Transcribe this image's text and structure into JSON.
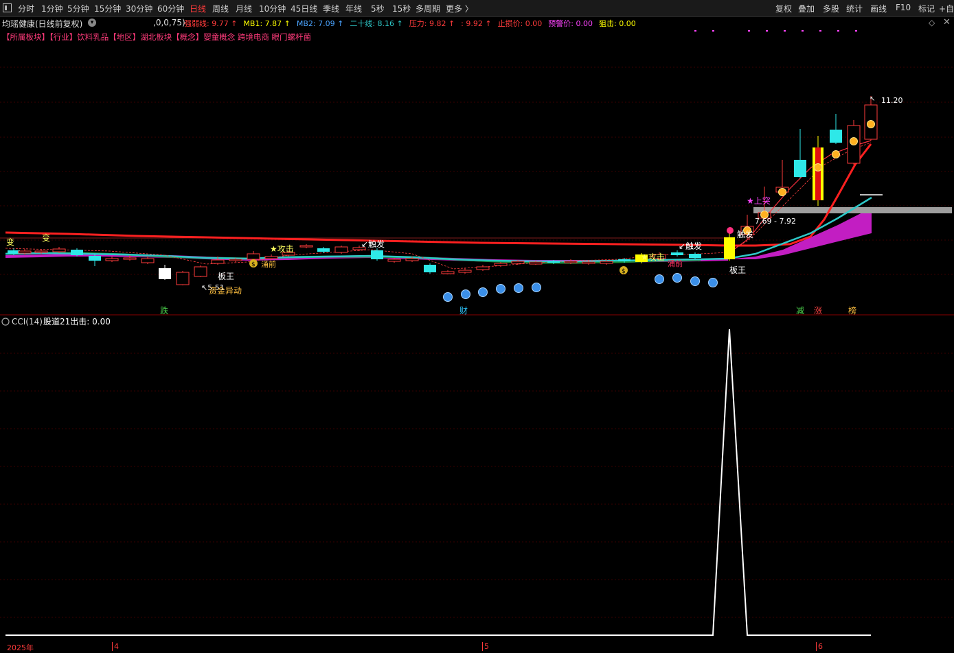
{
  "toolbar": {
    "tabs": [
      "分时",
      "1分钟",
      "5分钟",
      "15分钟",
      "30分钟",
      "60分钟",
      "日线",
      "周线",
      "月线",
      "10分钟",
      "45日线",
      "季线",
      "年线",
      "5秒",
      "15秒",
      "多周期",
      "更多 〉"
    ],
    "active_tab": "日线",
    "right_buttons": [
      "复权",
      "叠加",
      "多股",
      "统计",
      "画线",
      "F10",
      "标记",
      "+自"
    ]
  },
  "stock": {
    "title": "均瑶健康(日线前复权)",
    "params": ",0,0,75)",
    "indicators": [
      {
        "label": "强弱线:",
        "value": "9.77",
        "arrow": "↑",
        "color": "#ff3b3b"
      },
      {
        "label": "MB1:",
        "value": "7.87",
        "arrow": "↑",
        "color": "#ffff00"
      },
      {
        "label": "MB2:",
        "value": "7.09",
        "arrow": "↑",
        "color": "#4aa3ff"
      },
      {
        "label": "二十线:",
        "value": "8.16",
        "arrow": "↑",
        "color": "#2ec8c8"
      },
      {
        "label": "压力:",
        "value": "9.82",
        "arrow": "↑",
        "color": "#ff3b3b"
      },
      {
        "label": ":",
        "value": "9.92",
        "arrow": "↑",
        "color": "#ff3b3b"
      },
      {
        "label": "止损价:",
        "value": "0.00",
        "arrow": "",
        "color": "#ff3b3b"
      },
      {
        "label": "预警价:",
        "value": "0.00",
        "arrow": "",
        "color": "#ff44ff"
      },
      {
        "label": "狙击:",
        "value": "0.00",
        "arrow": "",
        "color": "#ffff00"
      }
    ],
    "sectors": "【所属板块】【行业】饮料乳品【地区】湖北板块【概念】婴童概念 跨境电商 眼门螺杆菌"
  },
  "main_labels": {
    "bian1": "变",
    "bian2": "变",
    "attack1": "★攻击",
    "attack2": "★攻击",
    "trigger1": "↙触发",
    "trigger2": "↙触发",
    "trigger3": "触发",
    "banwang1": "板王",
    "banwang2": "板王",
    "lowprice": "↖5.51",
    "capital": "资金异动",
    "yongqian": "涌前",
    "yongqian2": "涌前",
    "shangtu": "★上突",
    "range": "7.69 - 7.92",
    "high": "11.20",
    "die": "跌",
    "cai": "财",
    "jian": "减",
    "zhang": "涨",
    "bang": "榜",
    "dollar": "$"
  },
  "chart_data": {
    "type": "candlestick",
    "title": "均瑶健康(日线前复权)",
    "price_high": 11.2,
    "price_low": 5.51,
    "series": [
      {
        "name": "强弱线",
        "last": 9.77
      },
      {
        "name": "MB1",
        "last": 7.87
      },
      {
        "name": "MB2",
        "last": 7.09
      },
      {
        "name": "二十线",
        "last": 8.16
      },
      {
        "name": "压力",
        "last": 9.82
      }
    ]
  },
  "sub": {
    "title": "CCI(14)",
    "extra": "股道21出击: 0.00"
  },
  "dates": {
    "year": "2025年",
    "m4": "4",
    "m5": "5",
    "m6": "6"
  }
}
